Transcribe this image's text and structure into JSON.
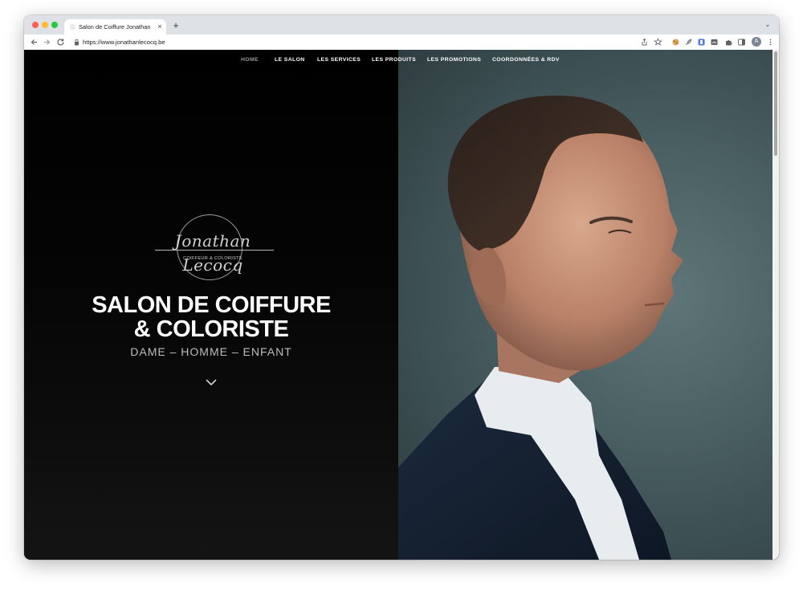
{
  "browser": {
    "tab_title": "Salon de Coiffure Jonathan Le",
    "tab_close": "×",
    "new_tab": "+",
    "tabs_menu": "⌄",
    "url": "https://www.jonathanlecocq.be",
    "profile_initial": "A"
  },
  "site": {
    "nav": [
      {
        "label": "HOME"
      },
      {
        "label": "LE SALON"
      },
      {
        "label": "LES SERVICES"
      },
      {
        "label": "LES PRODUITS"
      },
      {
        "label": "LES PROMOTIONS"
      },
      {
        "label": "COORDONNÉES & RDV"
      }
    ],
    "logo": {
      "script": "Jonathan Lecocq",
      "tagline": "COIFFEUR & COLORISTE"
    },
    "headline_line1": "SALON DE COIFFURE",
    "headline_line2": "& COLORISTE",
    "subline": "DAME – HOMME – ENFANT"
  },
  "colors": {
    "hero_left": "#000000",
    "hero_right_backdrop": "#4f6467",
    "text": "#ffffff",
    "nav_active": "#9a9a9a"
  }
}
